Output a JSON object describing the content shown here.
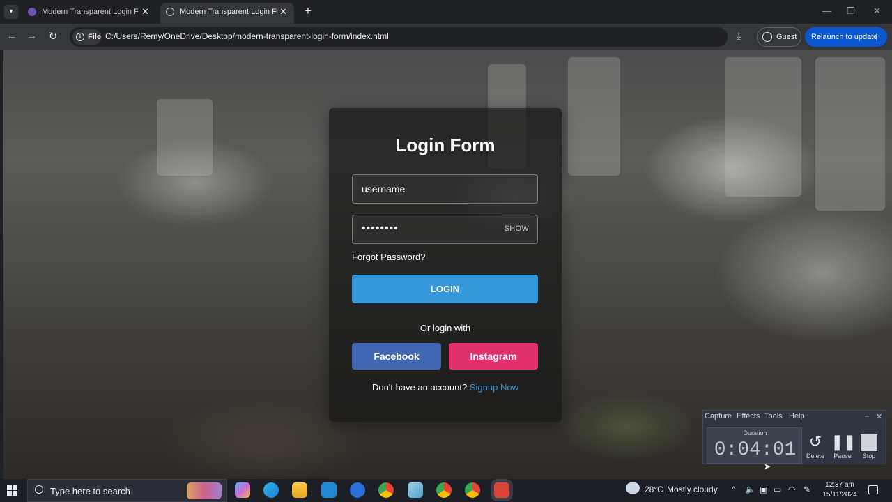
{
  "browser": {
    "tabs": [
      {
        "label": "Modern Transparent Login Form"
      },
      {
        "label": "Modern Transparent Login Form"
      }
    ],
    "new_tab_symbol": "+",
    "close_symbol": "✕",
    "url_scheme_chip": "File",
    "url": "C:/Users/Remy/OneDrive/Desktop/modern-transparent-login-form/index.html",
    "profile_label": "Guest",
    "relaunch_label": "Relaunch to update"
  },
  "login": {
    "title": "Login Form",
    "username_value": "username",
    "password_value": "••••••••",
    "show_toggle": "SHOW",
    "forgot": "Forgot Password?",
    "login_button": "LOGIN",
    "or_text": "Or login with",
    "facebook_button": "Facebook",
    "instagram_button": "Instagram",
    "signup_prompt": "Don't have an account?",
    "signup_link": "Signup Now",
    "colors": {
      "login": "#3498db",
      "facebook": "#4267b2",
      "instagram": "#e1306c"
    }
  },
  "recorder": {
    "menu": [
      "Capture",
      "Effects",
      "Tools",
      "Help"
    ],
    "duration_label": "Duration",
    "duration_value": "0:04:01",
    "delete_label": "Delete",
    "pause_label": "Pause",
    "stop_label": "Stop"
  },
  "taskbar": {
    "search_placeholder": "Type here to search",
    "weather_temp": "28°C",
    "weather_text": "Mostly cloudy",
    "time": "12:37 am",
    "date": "15/11/2024",
    "apps": [
      "copilot-icon",
      "edge-icon",
      "file-explorer-icon",
      "vscode-icon",
      "app-store-icon",
      "chrome-icon",
      "notepad-icon",
      "chrome-icon",
      "chrome-icon",
      "recorder-icon"
    ]
  }
}
